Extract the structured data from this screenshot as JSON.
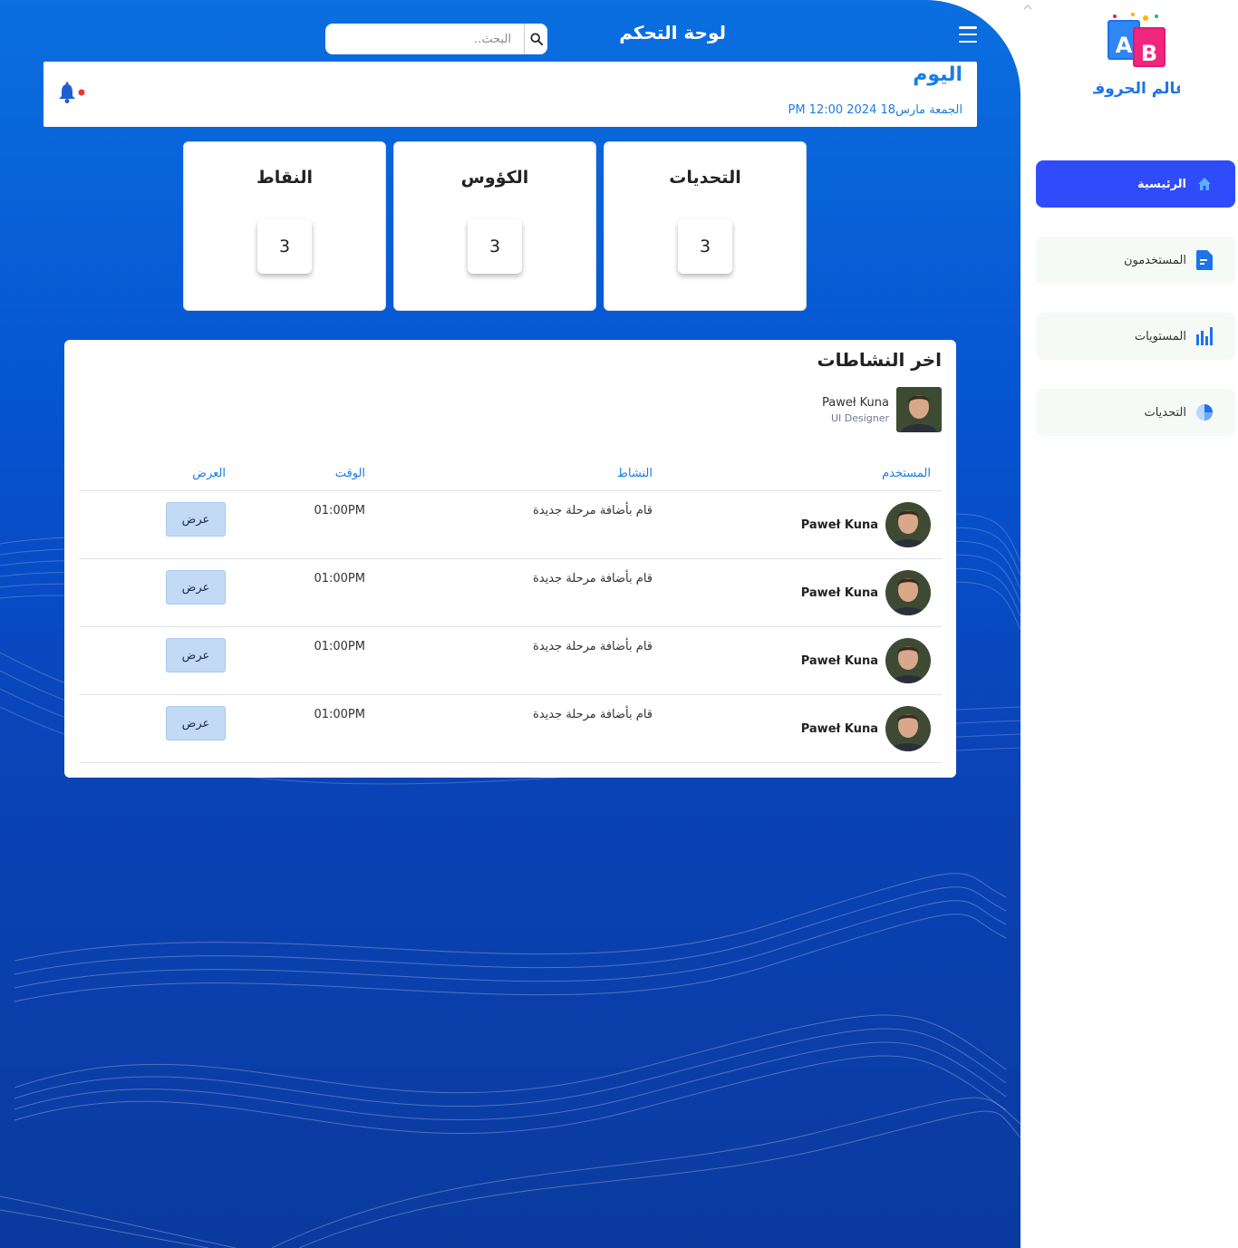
{
  "header": {
    "title": "لوحة التحكم",
    "search_placeholder": "البحث.."
  },
  "today": {
    "title": "اليوم",
    "date": "الجمعة مارس18 2024 PM 12:00"
  },
  "stats": [
    {
      "label": "التحديات",
      "value": "3"
    },
    {
      "label": "الكؤوس",
      "value": "3"
    },
    {
      "label": "النقاط",
      "value": "3"
    }
  ],
  "activity": {
    "title": "اخر النشاطات",
    "featured": {
      "name": "Paweł Kuna",
      "role": "UI Designer"
    },
    "columns": {
      "user": "المستخدم",
      "activity": "النشاط",
      "time": "الوقت",
      "view": "العرض"
    },
    "rows": [
      {
        "user": "Paweł Kuna",
        "activity": "قام بأضافة مرحلة جديدة",
        "time": "01:00PM",
        "action": "عرض"
      },
      {
        "user": "Paweł Kuna",
        "activity": "قام بأضافة مرحلة جديدة",
        "time": "01:00PM",
        "action": "عرض"
      },
      {
        "user": "Paweł Kuna",
        "activity": "قام بأضافة مرحلة جديدة",
        "time": "01:00PM",
        "action": "عرض"
      },
      {
        "user": "Paweł Kuna",
        "activity": "قام بأضافة مرحلة جديدة",
        "time": "01:00PM",
        "action": "عرض"
      }
    ]
  },
  "sidebar": {
    "logo_text": "عالم الحروف",
    "logo_letters": [
      "A",
      "B"
    ],
    "items": [
      {
        "label": "الرئيسية",
        "icon": "home-icon"
      },
      {
        "label": "المستخدمون",
        "icon": "document-icon"
      },
      {
        "label": "المستويات",
        "icon": "bar-chart-icon"
      },
      {
        "label": "التحديات",
        "icon": "pie-chart-icon"
      }
    ]
  },
  "colors": {
    "accent": "#1a7de4",
    "sidebar_active": "#2f4bfa",
    "notification_dot": "#e53935",
    "button_bg": "#c3daf7"
  }
}
